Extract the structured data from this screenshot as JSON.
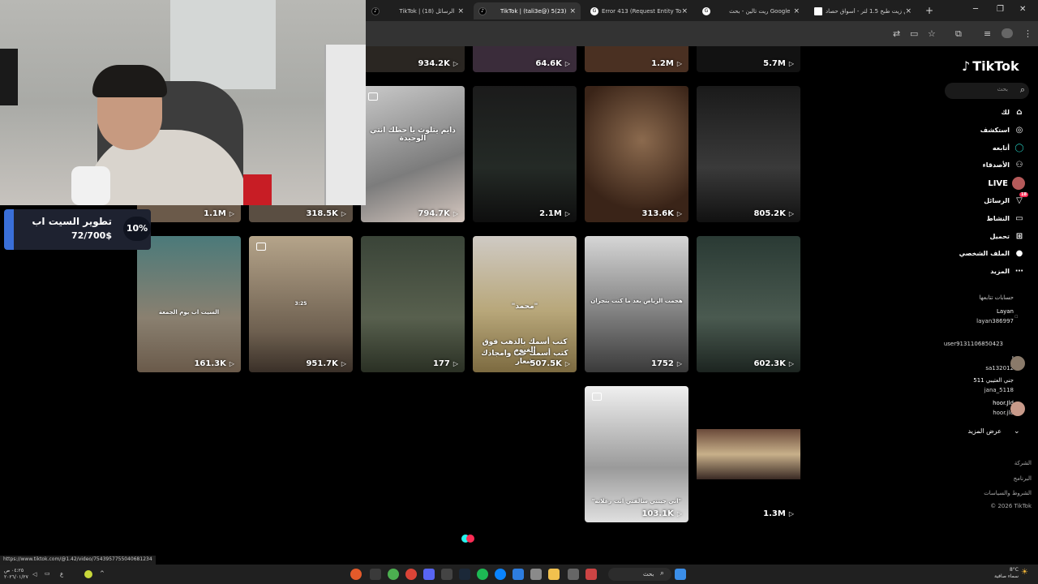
{
  "browser": {
    "tabs": [
      {
        "title": "TikTok | الرسائل (18)",
        "icon": "tiktok-icon",
        "active": false
      },
      {
        "title": "TikTok | (tali3e@) 5(23)",
        "icon": "tiktok-icon",
        "active": true
      },
      {
        "title": "Error 413 (Request Entity Too Large)",
        "icon": "google-icon",
        "active": false
      },
      {
        "title": "ريت تالين - بحث Google",
        "icon": "google-icon",
        "active": false
      },
      {
        "title": "تالين زيت طبخ 1.5 لتر - أسواق حصاد",
        "icon": "page-icon",
        "active": false
      }
    ],
    "status_url": "https://www.tiktok.com/@1.42/video/7543957755040681234"
  },
  "overlay": {
    "percent": "10%",
    "title": "تطوير السيت اب",
    "amount": "72/700$"
  },
  "videos": [
    {
      "views": "934.2K"
    },
    {
      "views": "64.6K"
    },
    {
      "views": "1.2M"
    },
    {
      "views": "5.7M"
    },
    {
      "views": "1.1M"
    },
    {
      "views": "318.5K"
    },
    {
      "views": "794.7K"
    },
    {
      "views": "2.1M"
    },
    {
      "views": "313.6K"
    },
    {
      "views": "805.2K"
    },
    {
      "views": "161.3K"
    },
    {
      "views": "951.7K"
    },
    {
      "views": "177"
    },
    {
      "views": "507.5K"
    },
    {
      "views": "1752"
    },
    {
      "views": "602.3K"
    },
    {
      "views": "103.1K"
    },
    {
      "views": "1.3M"
    }
  ],
  "captions": {
    "c1": "دايم يتلوث يا حظك انتي الوحيدة",
    "c2": "\"محمد\"",
    "c3": "كتب أسمك بالذهب فوق الغيوم",
    "c4": "كتب أسمك حب وامجادك شعار",
    "c5": "هجمت الرياض بعد ما كنت بنجران",
    "c6": "\"اني جيتني سالفتي انت زعلانه\"",
    "c7": "السيت اب يوم الجمعة",
    "time_overlay": "3:25"
  },
  "sidebar": {
    "logo": "TikTok",
    "search_placeholder": "بحث",
    "nav": [
      {
        "label": "لك",
        "icon": "home-icon"
      },
      {
        "label": "استكشف",
        "icon": "compass-icon"
      },
      {
        "label": "أتابعه",
        "icon": "following-icon"
      },
      {
        "label": "الأصدقاء",
        "icon": "friends-icon"
      },
      {
        "label": "LIVE",
        "icon": "live-avatar-icon"
      },
      {
        "label": "الرسائل",
        "icon": "messages-icon"
      },
      {
        "label": "النشاط",
        "icon": "activity-icon"
      },
      {
        "label": "تحميل",
        "icon": "upload-icon"
      },
      {
        "label": "الملف الشخصي",
        "icon": "profile-icon"
      },
      {
        "label": "المزيد",
        "icon": "more-icon"
      }
    ],
    "messages_badge": "18",
    "following_header": "حسابات تتابعها",
    "accounts": [
      {
        "name": "Layan",
        "handle": "layan386997"
      },
      {
        "name": "",
        "handle": "user9131106850423"
      },
      {
        "name": "J",
        "handle": "sa132012"
      },
      {
        "name": "جني العتيبي 511",
        "handle": "jana_5118"
      },
      {
        "name": "hoor.Jld",
        "handle": "hoor.jld"
      }
    ],
    "see_more": "عرض المزيد",
    "footer": [
      "الشركة",
      "البرنامج",
      "الشروط والسياسات",
      "© 2026 TikTok"
    ]
  },
  "taskbar": {
    "search": "بحث",
    "weather_temp": "8°C",
    "weather_desc": "سماء صافية",
    "time": "٠٤:٢٥ ص",
    "date": "٢٠٢٦/٠١/٢٧"
  }
}
